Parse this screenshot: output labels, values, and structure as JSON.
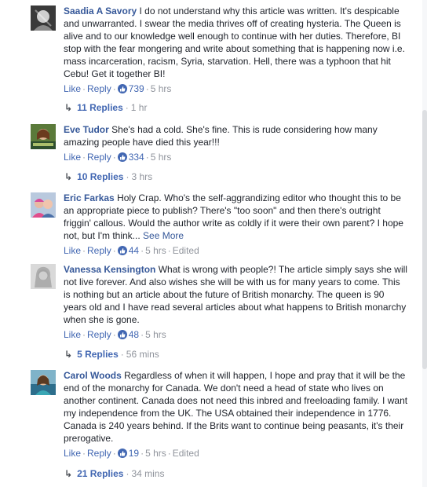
{
  "comments": [
    {
      "author": "Saadia A Savory",
      "text": "I do not understand why this article was written. It's despicable and unwarranted. I swear the media thrives off of creating hysteria. The Queen is alive and to our knowledge well enough to continue with her duties. Therefore, BI stop with the fear mongering and write about something that is happening now i.e. mass incarceration, racism, Syria, starvation. Hell, there was a typhoon that hit Cebu! Get it together BI!",
      "like": "Like",
      "reply": "Reply",
      "likes": "739",
      "time": "5 hrs",
      "replies": "11 Replies",
      "replies_time": "1 hr"
    },
    {
      "author": "Eve Tudor",
      "text": "She's had a cold. She's fine. This is rude considering how many amazing people have died this year!!!",
      "like": "Like",
      "reply": "Reply",
      "likes": "334",
      "time": "5 hrs",
      "replies": "10 Replies",
      "replies_time": "3 hrs"
    },
    {
      "author": "Eric Farkas",
      "text": "Holy Crap. Who's the self-aggrandizing editor who thought this to be an appropriate piece to publish? There's \"too soon\" and then there's outright friggin' callous. Would the author write as coldly if it were their own parent? I hope not, but I'm think...",
      "see_more": "See More",
      "like": "Like",
      "reply": "Reply",
      "likes": "44",
      "time": "5 hrs",
      "edited": "Edited"
    },
    {
      "author": "Vanessa Kensington",
      "text": "What is wrong with people?! The article simply says she will not live forever. And also wishes she will be with us for many years to come. This is nothing but an article about the future of British monarchy. The queen is 90 years old and I have read several articles about what happens to British monarchy when she is gone.",
      "like": "Like",
      "reply": "Reply",
      "likes": "48",
      "time": "5 hrs",
      "replies": "5 Replies",
      "replies_time": "56 mins"
    },
    {
      "author": "Carol Woods",
      "text": "Regardless of when it will happen, I hope and pray that it will be the end of the monarchy for Canada. We don't need a head of state who lives on another continent. Canada does not need this inbred and freeloading family. I want my independence from the UK. The USA obtained their independence in 1776. Canada is 240 years behind. If the Brits want to continue being peasants, it's their prerogative.",
      "like": "Like",
      "reply": "Reply",
      "likes": "19",
      "time": "5 hrs",
      "edited": "Edited",
      "replies": "21 Replies",
      "replies_time": "34 mins"
    }
  ],
  "colors": {
    "author": "#365899",
    "link": "#4267b2",
    "meta": "#90949c",
    "text": "#1d2129"
  }
}
